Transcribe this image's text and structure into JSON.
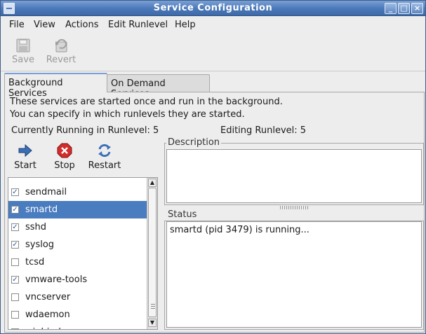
{
  "window": {
    "title": "Service Configuration",
    "controls": [
      "_",
      "□",
      "×"
    ]
  },
  "menu": {
    "file": "File",
    "view": "View",
    "actions": "Actions",
    "edit_runlevel": "Edit Runlevel",
    "help": "Help"
  },
  "toolbar": {
    "save_label": "Save",
    "revert_label": "Revert"
  },
  "tabs": [
    {
      "label": "Background Services",
      "active": true
    },
    {
      "label": "On Demand Services",
      "active": false
    }
  ],
  "panel": {
    "description_line1": "These services are started once and run in the background.",
    "description_line2": "You can specify in which runlevels they are started.",
    "currently_running": "Currently Running in Runlevel: 5",
    "editing_runlevel": "Editing Runlevel: 5"
  },
  "actions": {
    "start_label": "Start",
    "stop_label": "Stop",
    "restart_label": "Restart"
  },
  "services": [
    {
      "name": "sendmail",
      "checked": true,
      "selected": false
    },
    {
      "name": "smartd",
      "checked": true,
      "selected": true
    },
    {
      "name": "sshd",
      "checked": true,
      "selected": false
    },
    {
      "name": "syslog",
      "checked": true,
      "selected": false
    },
    {
      "name": "tcsd",
      "checked": false,
      "selected": false
    },
    {
      "name": "vmware-tools",
      "checked": true,
      "selected": false
    },
    {
      "name": "vncserver",
      "checked": false,
      "selected": false
    },
    {
      "name": "wdaemon",
      "checked": false,
      "selected": false
    },
    {
      "name": "winbind",
      "checked": false,
      "selected": false
    }
  ],
  "description_frame": {
    "label": "Description",
    "text": ""
  },
  "status_frame": {
    "label": "Status",
    "text": "smartd (pid 3479) is running..."
  },
  "colors": {
    "titlebar": "#4a77b8",
    "selection": "#4a7cc0",
    "stop_icon": "#d22c2c",
    "start_icon": "#3a6fb7"
  }
}
